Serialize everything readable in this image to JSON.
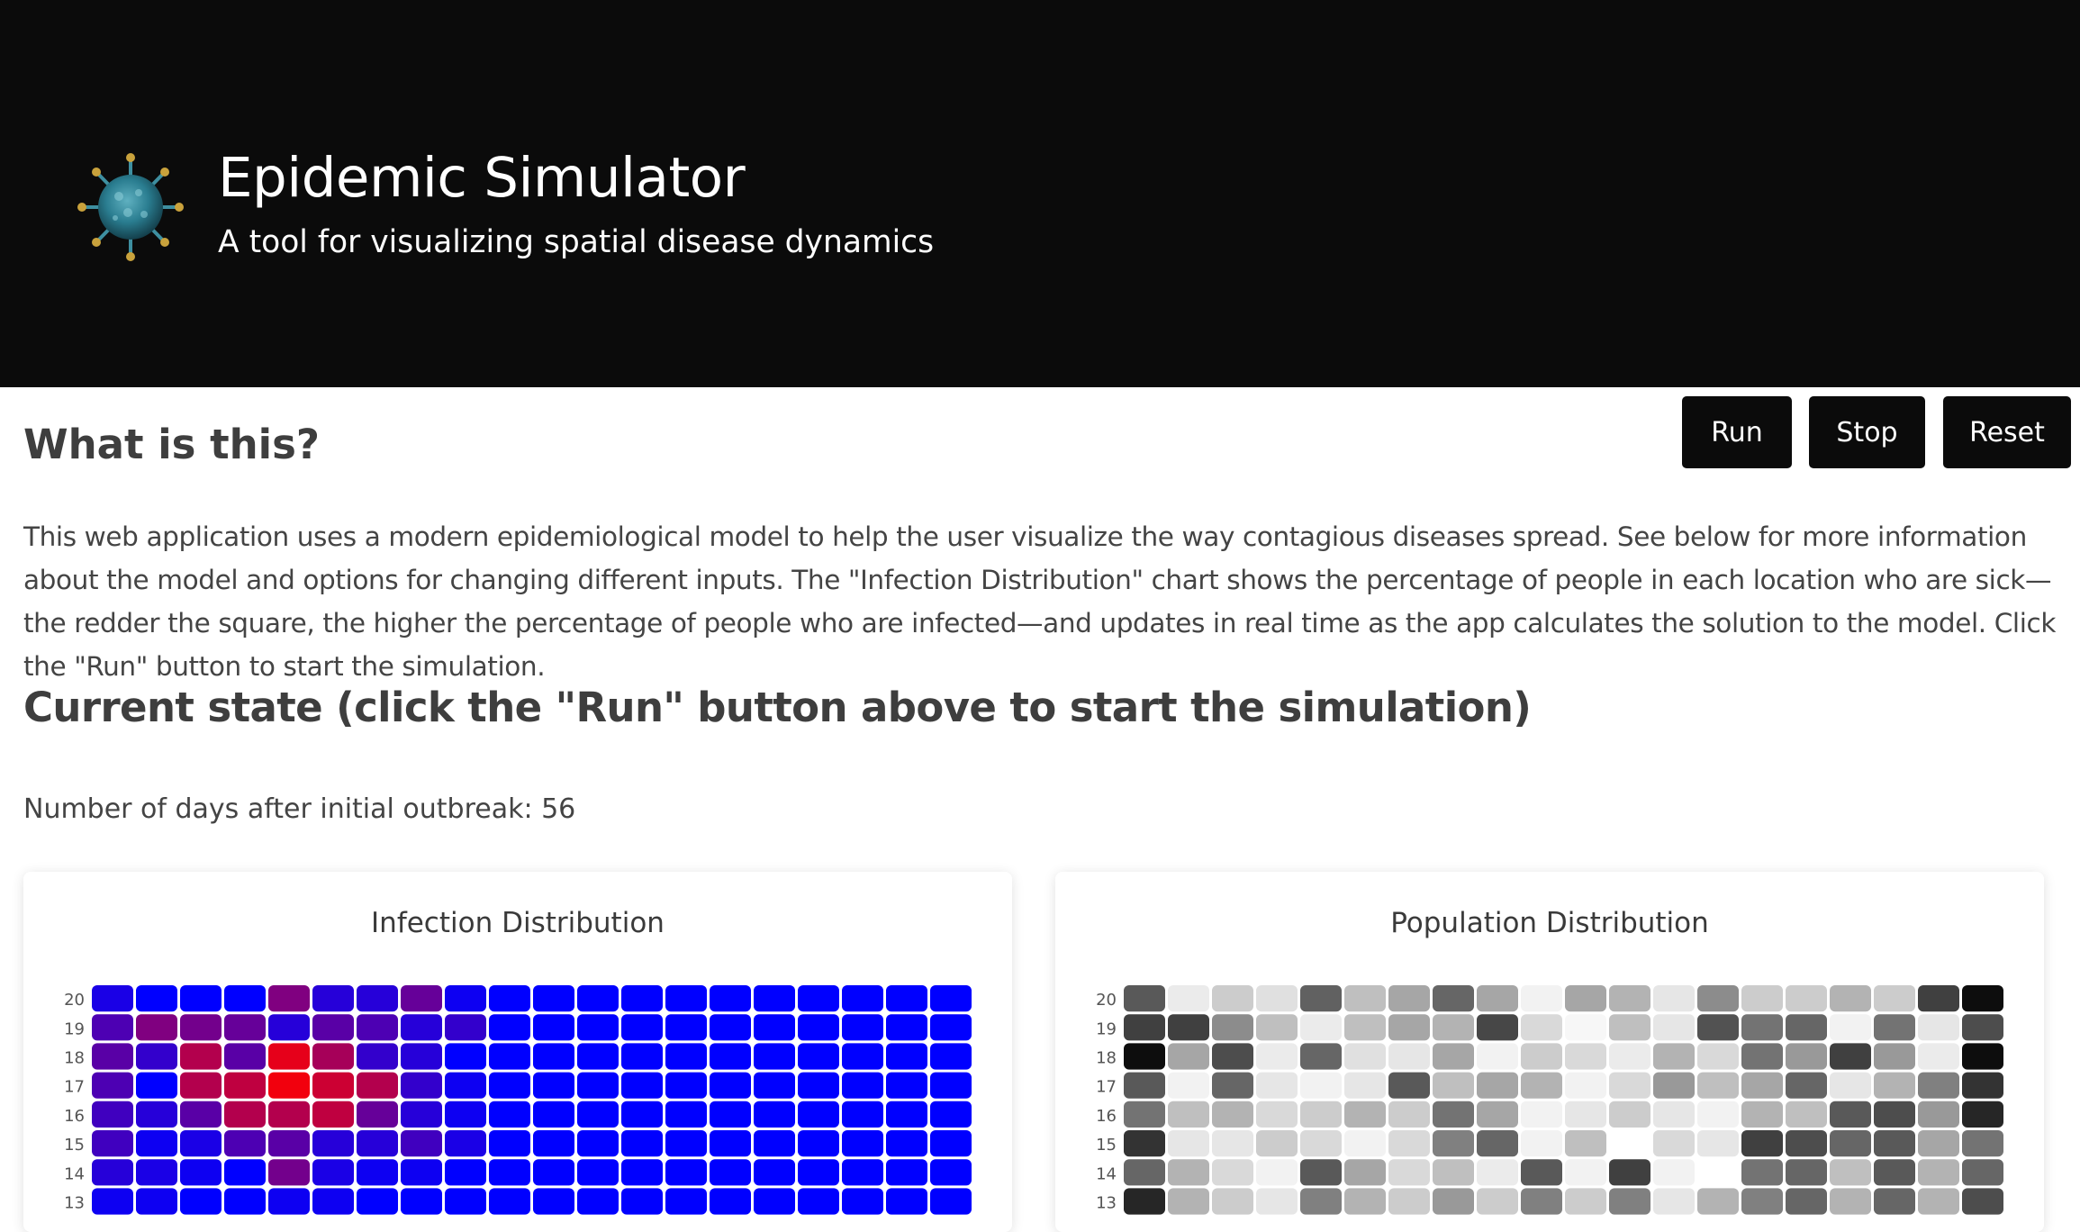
{
  "header": {
    "title": "Epidemic Simulator",
    "subtitle": "A tool for visualizing spatial disease dynamics",
    "logo_icon": "virus-icon"
  },
  "controls": {
    "run_label": "Run",
    "stop_label": "Stop",
    "reset_label": "Reset"
  },
  "intro": {
    "heading": "What is this?",
    "text": "This web application uses a modern epidemiological model to help the user visualize the way contagious diseases spread. See below for more information about the model and options for changing different inputs. The \"Infection Distribution\" chart shows the percentage of people in each location who are sick—the redder the square, the higher the percentage of people who are infected—and updates in real time as the app calculates the solution to the model. Click the \"Run\" button to start the simulation."
  },
  "state": {
    "heading": "Current state (click the \"Run\" button above to start the simulation)",
    "days_text": "Number of days after initial outbreak: 56"
  },
  "chart_data": [
    {
      "type": "heatmap",
      "title": "Infection Distribution",
      "color_scale": [
        "#0000ff",
        "#ff0000"
      ],
      "y_ticks": [
        20,
        19,
        18,
        17,
        16,
        15,
        14,
        13
      ],
      "columns": 20,
      "values": [
        [
          0.1,
          0.0,
          0.0,
          0.0,
          0.5,
          0.15,
          0.15,
          0.4,
          0.05,
          0.0,
          0.0,
          0.0,
          0.0,
          0.0,
          0.0,
          0.0,
          0.0,
          0.0,
          0.0,
          0.0
        ],
        [
          0.3,
          0.5,
          0.45,
          0.4,
          0.15,
          0.35,
          0.3,
          0.15,
          0.2,
          0.0,
          0.0,
          0.0,
          0.0,
          0.0,
          0.0,
          0.0,
          0.0,
          0.0,
          0.0,
          0.0
        ],
        [
          0.35,
          0.2,
          0.7,
          0.35,
          0.9,
          0.65,
          0.2,
          0.15,
          0.0,
          0.0,
          0.0,
          0.0,
          0.0,
          0.0,
          0.0,
          0.0,
          0.0,
          0.0,
          0.0,
          0.0
        ],
        [
          0.3,
          0.0,
          0.7,
          0.75,
          0.95,
          0.8,
          0.7,
          0.2,
          0.05,
          0.0,
          0.0,
          0.0,
          0.0,
          0.0,
          0.0,
          0.0,
          0.0,
          0.0,
          0.0,
          0.0
        ],
        [
          0.25,
          0.15,
          0.35,
          0.7,
          0.7,
          0.75,
          0.4,
          0.15,
          0.05,
          0.0,
          0.0,
          0.0,
          0.0,
          0.0,
          0.0,
          0.0,
          0.0,
          0.0,
          0.0,
          0.0
        ],
        [
          0.25,
          0.05,
          0.1,
          0.3,
          0.35,
          0.15,
          0.15,
          0.25,
          0.1,
          0.0,
          0.0,
          0.0,
          0.0,
          0.0,
          0.0,
          0.0,
          0.0,
          0.0,
          0.0,
          0.0
        ],
        [
          0.15,
          0.1,
          0.05,
          0.0,
          0.45,
          0.1,
          0.05,
          0.05,
          0.0,
          0.0,
          0.0,
          0.0,
          0.0,
          0.0,
          0.0,
          0.0,
          0.0,
          0.0,
          0.0,
          0.0
        ],
        [
          0.05,
          0.05,
          0.0,
          0.0,
          0.05,
          0.05,
          0.0,
          0.0,
          0.0,
          0.0,
          0.0,
          0.0,
          0.0,
          0.0,
          0.0,
          0.0,
          0.0,
          0.0,
          0.0,
          0.0
        ]
      ]
    },
    {
      "type": "heatmap",
      "title": "Population Distribution",
      "color_scale": [
        "#ffffff",
        "#000000"
      ],
      "y_ticks": [
        20,
        19,
        18,
        17,
        16,
        15,
        14,
        13
      ],
      "columns": 20,
      "values": [
        [
          0.65,
          0.08,
          0.2,
          0.12,
          0.62,
          0.25,
          0.35,
          0.6,
          0.35,
          0.05,
          0.35,
          0.3,
          0.1,
          0.45,
          0.2,
          0.2,
          0.3,
          0.2,
          0.75,
          0.95
        ],
        [
          0.75,
          0.75,
          0.45,
          0.25,
          0.08,
          0.25,
          0.35,
          0.3,
          0.72,
          0.15,
          0.03,
          0.25,
          0.1,
          0.68,
          0.55,
          0.6,
          0.05,
          0.55,
          0.1,
          0.7
        ],
        [
          0.95,
          0.35,
          0.7,
          0.08,
          0.6,
          0.12,
          0.1,
          0.35,
          0.05,
          0.2,
          0.15,
          0.08,
          0.3,
          0.15,
          0.55,
          0.4,
          0.75,
          0.4,
          0.08,
          0.95
        ],
        [
          0.65,
          0.05,
          0.6,
          0.1,
          0.05,
          0.1,
          0.65,
          0.25,
          0.35,
          0.3,
          0.05,
          0.15,
          0.4,
          0.25,
          0.35,
          0.6,
          0.1,
          0.3,
          0.5,
          0.8
        ],
        [
          0.55,
          0.25,
          0.3,
          0.15,
          0.2,
          0.3,
          0.2,
          0.55,
          0.35,
          0.05,
          0.1,
          0.2,
          0.1,
          0.05,
          0.3,
          0.25,
          0.65,
          0.7,
          0.4,
          0.85
        ],
        [
          0.8,
          0.1,
          0.1,
          0.2,
          0.15,
          0.05,
          0.15,
          0.5,
          0.6,
          0.05,
          0.25,
          0.0,
          0.15,
          0.1,
          0.75,
          0.7,
          0.6,
          0.65,
          0.35,
          0.55
        ],
        [
          0.6,
          0.3,
          0.15,
          0.05,
          0.65,
          0.35,
          0.15,
          0.25,
          0.08,
          0.65,
          0.05,
          0.75,
          0.05,
          0.0,
          0.55,
          0.6,
          0.25,
          0.65,
          0.3,
          0.6
        ],
        [
          0.85,
          0.3,
          0.2,
          0.1,
          0.5,
          0.3,
          0.2,
          0.4,
          0.2,
          0.5,
          0.2,
          0.5,
          0.1,
          0.3,
          0.5,
          0.6,
          0.3,
          0.6,
          0.3,
          0.7
        ]
      ]
    }
  ]
}
